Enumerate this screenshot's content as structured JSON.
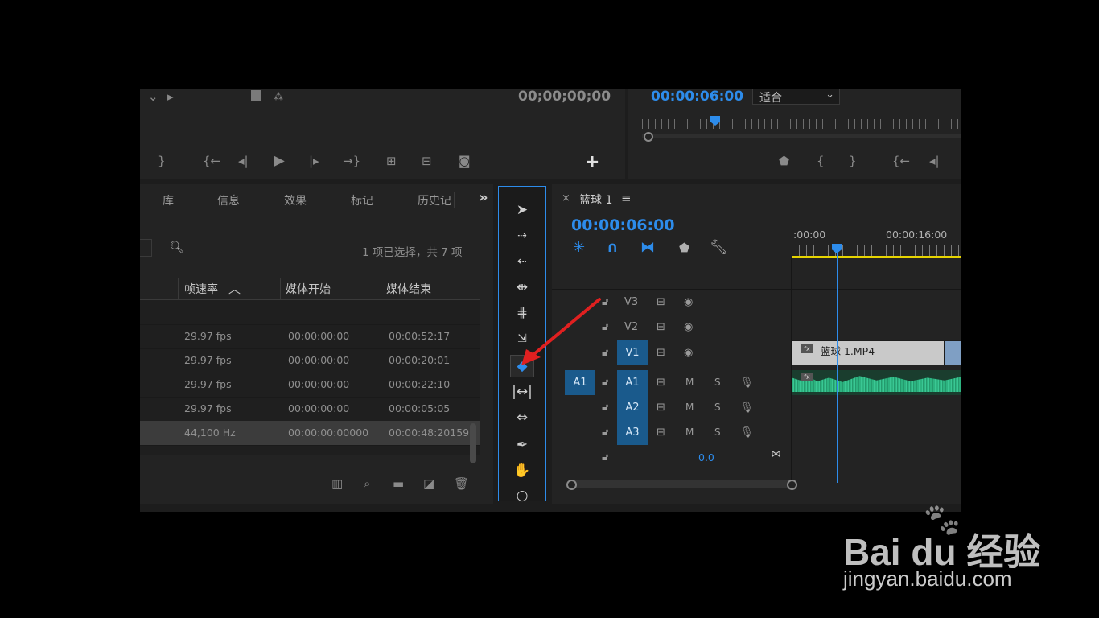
{
  "source_monitor": {
    "timecode": "00;00;00;00",
    "add_label": "+"
  },
  "program_monitor": {
    "timecode": "00:00:06:00",
    "fit_select": "适合"
  },
  "project_panel": {
    "tabs": [
      "库",
      "信息",
      "效果",
      "标记",
      "历史记"
    ],
    "more_label": "»",
    "selection_status": "1 项已选择，共 7 项",
    "columns": [
      "帧速率",
      "媒体开始",
      "媒体结束"
    ],
    "rows": [
      {
        "rate": "29.97 fps",
        "start": "00:00:00:00",
        "end": "00:00:52:17"
      },
      {
        "rate": "29.97 fps",
        "start": "00:00:00:00",
        "end": "00:00:20:01"
      },
      {
        "rate": "29.97 fps",
        "start": "00:00:00:00",
        "end": "00:00:22:10"
      },
      {
        "rate": "29.97 fps",
        "start": "00:00:00:00",
        "end": "00:00:05:05"
      },
      {
        "rate": "44,100 Hz",
        "start": "00:00:00:00000",
        "end": "00:00:48:20159"
      }
    ]
  },
  "timeline": {
    "close_label": "×",
    "sequence_name": "篮球 1",
    "menu_label": "≡",
    "timecode": "00:00:06:00",
    "ruler_labels": [
      ":00:00",
      "00:00:16:00"
    ],
    "video_tracks": [
      {
        "name": "V3",
        "active": false
      },
      {
        "name": "V2",
        "active": false
      },
      {
        "name": "V1",
        "active": true
      }
    ],
    "audio_tracks": [
      {
        "source": "A1",
        "name": "A1",
        "m": "M",
        "s": "S"
      },
      {
        "source": "",
        "name": "A2",
        "m": "M",
        "s": "S"
      },
      {
        "source": "",
        "name": "A3",
        "m": "M",
        "s": "S"
      }
    ],
    "master_volume": "0.0",
    "clip_name": "篮球 1.MP4",
    "fx_label": "fx"
  },
  "colors": {
    "accent": "#2d8ceb",
    "video_clip": "#c9c9c9",
    "audio_clip": "#2db380",
    "annotation_arrow": "#e02020"
  },
  "watermark": {
    "brand": "Bai du 经验",
    "url": "jingyan.baidu.com"
  }
}
